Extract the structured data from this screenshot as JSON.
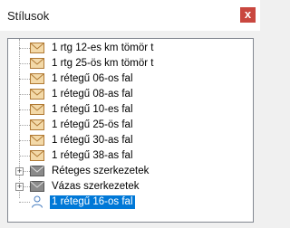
{
  "window": {
    "title": "Stílusok",
    "close_symbol": "x"
  },
  "tree": {
    "items": [
      {
        "label": "1 rtg 12-es km tömör t",
        "icon": "envelope-icon"
      },
      {
        "label": "1 rtg 25-ös km tömör t",
        "icon": "envelope-icon"
      },
      {
        "label": "1 rétegű 06-os fal",
        "icon": "envelope-icon"
      },
      {
        "label": "1 rétegű 08-as fal",
        "icon": "envelope-icon"
      },
      {
        "label": "1 rétegű 10-es fal",
        "icon": "envelope-icon"
      },
      {
        "label": "1 rétegű 25-ös fal",
        "icon": "envelope-icon"
      },
      {
        "label": "1 rétegű 30-as fal",
        "icon": "envelope-icon"
      },
      {
        "label": "1 rétegű 38-as fal",
        "icon": "envelope-icon"
      },
      {
        "label": "Réteges szerkezetek",
        "icon": "gray-envelope-icon",
        "expandable": true
      },
      {
        "label": "Vázas szerkezetek",
        "icon": "gray-envelope-icon",
        "expandable": true
      },
      {
        "label": "1 rétegű 16-os fal",
        "icon": "person-icon",
        "selected": true
      }
    ]
  },
  "colors": {
    "envelope": "#d9a15a",
    "envelope_gray": "#707070",
    "selection": "#0078d7",
    "close_button": "#c9473f"
  }
}
